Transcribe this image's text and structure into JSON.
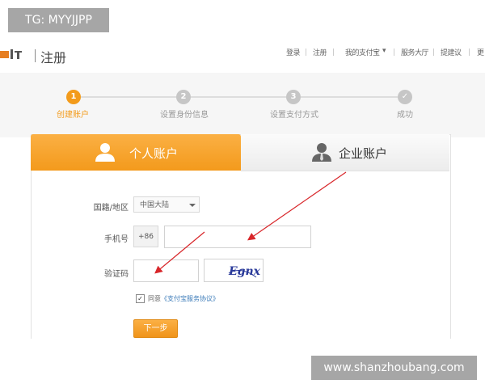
{
  "header": {
    "title": "注册",
    "top_links": [
      "登录",
      "注册",
      "我的支付宝",
      "服务大厅",
      "提建议",
      "更"
    ]
  },
  "steps": [
    {
      "number": "1",
      "label": "创建账户"
    },
    {
      "number": "2",
      "label": "设置身份信息"
    },
    {
      "number": "3",
      "label": "设置支付方式"
    },
    {
      "number": "✓",
      "label": "成功"
    }
  ],
  "tabs": {
    "personal": "个人账户",
    "company": "企业账户"
  },
  "form": {
    "region_label": "国籍/地区",
    "region_value": "中国大陆",
    "phone_label": "手机号",
    "phone_prefix": "+86",
    "code_label": "验证码",
    "captcha_text": "Egnx",
    "agree_prefix": "同意",
    "agree_link": "《支付宝服务协议》",
    "next_button": "下一步"
  },
  "watermarks": {
    "top_left": "TG: MYYJJPP",
    "bottom_right": "www.shanzhoubang.com"
  },
  "colors": {
    "accent": "#f39b1b",
    "arrow": "#d8262a",
    "link": "#3a7ab8"
  }
}
